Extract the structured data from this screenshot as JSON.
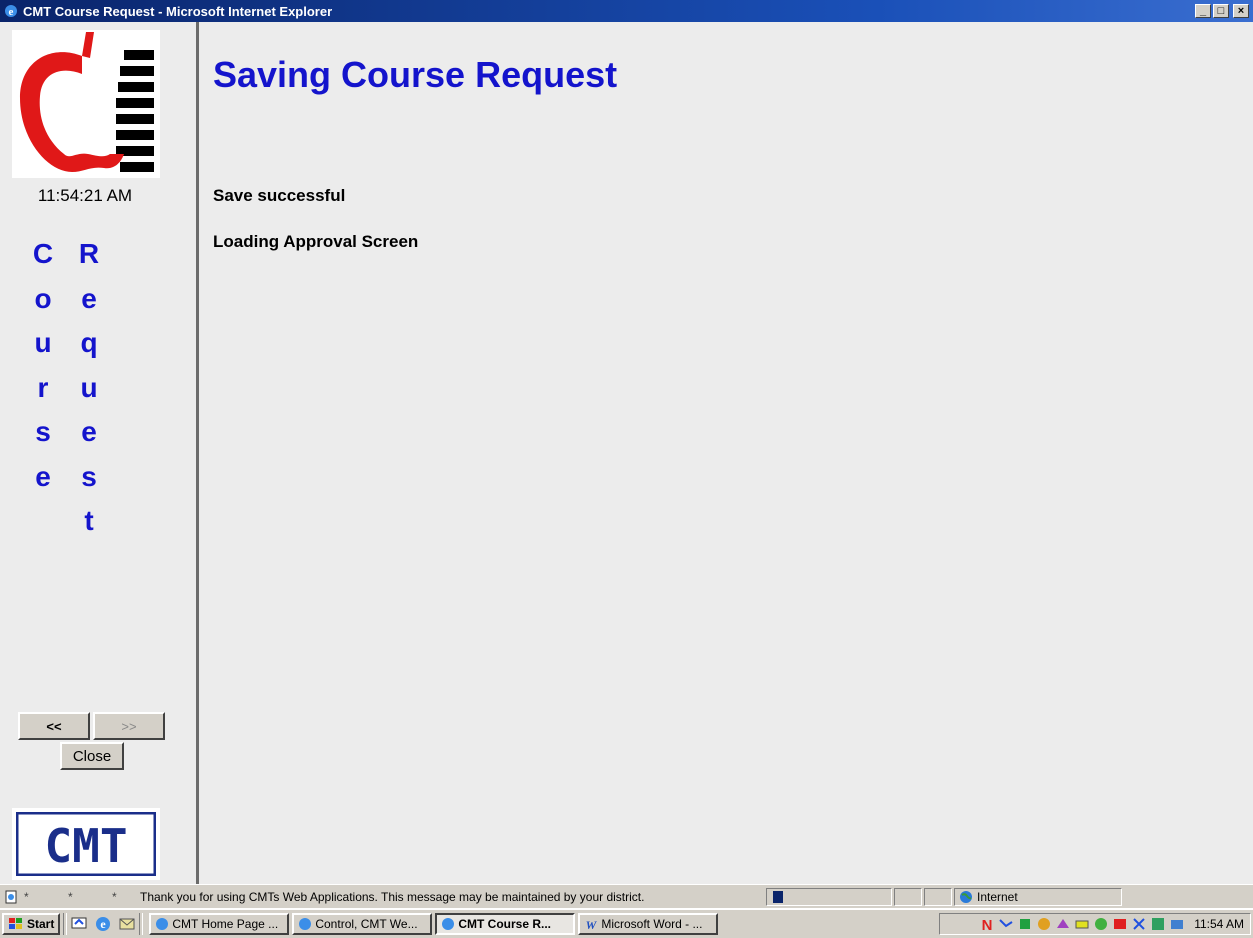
{
  "window": {
    "title": "CMT Course Request - Microsoft Internet Explorer",
    "minimize": "_",
    "maximize": "□",
    "close": "×"
  },
  "sidebar": {
    "clock": "11:54:21 AM",
    "vertical_word_1": [
      "C",
      "o",
      "u",
      "r",
      "s",
      "e"
    ],
    "vertical_word_2": [
      "R",
      "e",
      "q",
      "u",
      "e",
      "s",
      "t"
    ],
    "prev_label": "<<",
    "next_label": ">>",
    "close_label": "Close",
    "logo_text": "CMT"
  },
  "main": {
    "heading": "Saving Course Request",
    "message_1": "Save successful",
    "message_2": "Loading Approval Screen"
  },
  "statusbar": {
    "stars": "* * *",
    "message": "Thank you for using CMTs Web Applications.  This message may be maintained by your district.",
    "zone": "Internet"
  },
  "taskbar": {
    "start_label": "Start",
    "tasks": [
      {
        "label": "CMT Home Page ...",
        "icon": "ie-icon",
        "active": false
      },
      {
        "label": "Control, CMT We...",
        "icon": "ie-icon",
        "active": false
      },
      {
        "label": "CMT Course R...",
        "icon": "ie-icon",
        "active": true
      },
      {
        "label": "Microsoft Word - ...",
        "icon": "word-icon",
        "active": false
      }
    ],
    "clock": "11:54 AM"
  },
  "colors": {
    "accent_blue": "#1414cc",
    "titlebar": "#0a246a",
    "apple_red": "#e01818"
  }
}
